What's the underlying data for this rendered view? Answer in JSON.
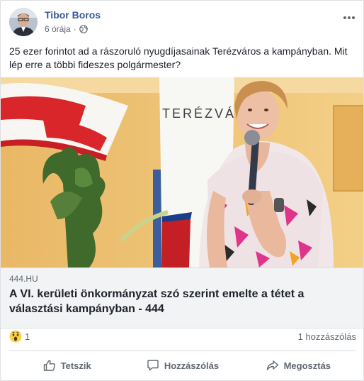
{
  "post": {
    "author": "Tibor Boros",
    "time": "6 órája",
    "privacy_icon": "globe-icon",
    "text": "25 ezer forintot ad a rászoruló nyugdíjasainak Terézváros a kampányban. Mit lép erre a többi fideszes polgármester?"
  },
  "link": {
    "image_sign_text": "TERÉZVÁ",
    "domain": "444.HU",
    "title": "A VI. kerületi önkormányzat szó szerint emelte a tétet a választási kampányban - 444"
  },
  "stats": {
    "reaction_icon": "wow-reaction-icon",
    "reaction_count": "1",
    "comments": "1 hozzászólás"
  },
  "actions": {
    "like": "Tetszik",
    "comment": "Hozzászólás",
    "share": "Megosztás"
  },
  "colors": {
    "author_link": "#365899",
    "wall_orange": "#f0c878",
    "link_box_bg": "#f2f3f5"
  }
}
